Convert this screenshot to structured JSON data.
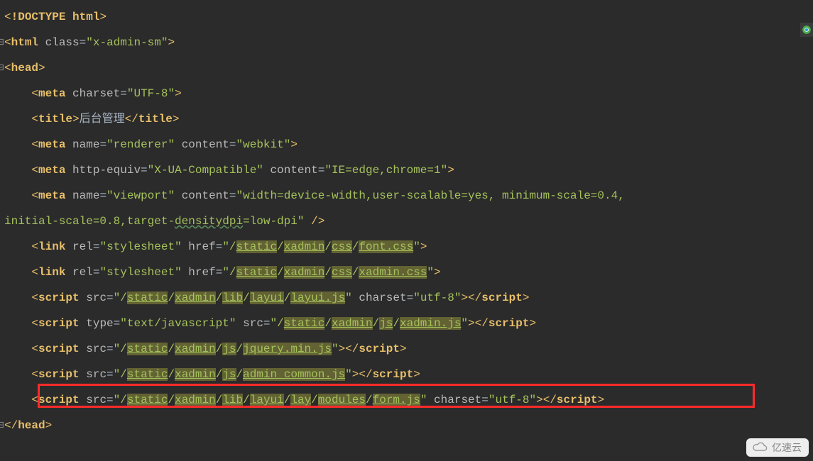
{
  "lines": {
    "l1": {
      "tag": "!DOCTYPE html"
    },
    "l2": {
      "tag": "html",
      "a1": "class",
      "v1": "x-admin-sm"
    },
    "l3": {
      "tag": "head"
    },
    "l4": {
      "tag": "meta",
      "a1": "charset",
      "v1": "UTF-8"
    },
    "l5": {
      "tag": "title",
      "text": "后台管理"
    },
    "l6": {
      "tag": "meta",
      "a1": "name",
      "v1": "renderer",
      "a2": "content",
      "v2": "webkit"
    },
    "l7": {
      "tag": "meta",
      "a1": "http-equiv",
      "v1": "X-UA-Compatible",
      "a2": "content",
      "v2": "IE=edge,chrome=1"
    },
    "l8a": {
      "tag": "meta",
      "a1": "name",
      "v1": "viewport",
      "a2": "content",
      "v2a": "width=device-width,user-scalable=yes, minimum-scale=0.4, "
    },
    "l8b": {
      "v2b_pre": "initial-scale=0.8,target-",
      "v2b_typo": "densitydpi",
      "v2b_post": "=low-dpi"
    },
    "l9": {
      "tag": "link",
      "a1": "rel",
      "v1": "stylesheet",
      "a2": "href",
      "p": [
        "static",
        "xadmin",
        "css",
        "font.css"
      ]
    },
    "l10": {
      "tag": "link",
      "a1": "rel",
      "v1": "stylesheet",
      "a2": "href",
      "p": [
        "static",
        "xadmin",
        "css",
        "xadmin.css"
      ]
    },
    "l11": {
      "tag": "script",
      "a1": "src",
      "p": [
        "static",
        "xadmin",
        "lib",
        "layui",
        "layui.js"
      ],
      "a2": "charset",
      "v2": "utf-8"
    },
    "l12": {
      "tag": "script",
      "a1": "type",
      "v1": "text/javascript",
      "a2": "src",
      "p": [
        "static",
        "xadmin",
        "js",
        "xadmin.js"
      ]
    },
    "l13": {
      "tag": "script",
      "a1": "src",
      "p": [
        "static",
        "xadmin",
        "js",
        "jquery.min.js"
      ]
    },
    "l14": {
      "tag": "script",
      "a1": "src",
      "p": [
        "static",
        "xadmin",
        "js",
        "admin_common.js"
      ]
    },
    "l15": {
      "tag": "script",
      "a1": "src",
      "p": [
        "static",
        "xadmin",
        "lib",
        "layui",
        "lay",
        "modules",
        "form.js"
      ],
      "a2": "charset",
      "v2": "utf-8"
    },
    "l16": {
      "tag": "head",
      "close": true
    }
  },
  "watermark": "亿速云"
}
